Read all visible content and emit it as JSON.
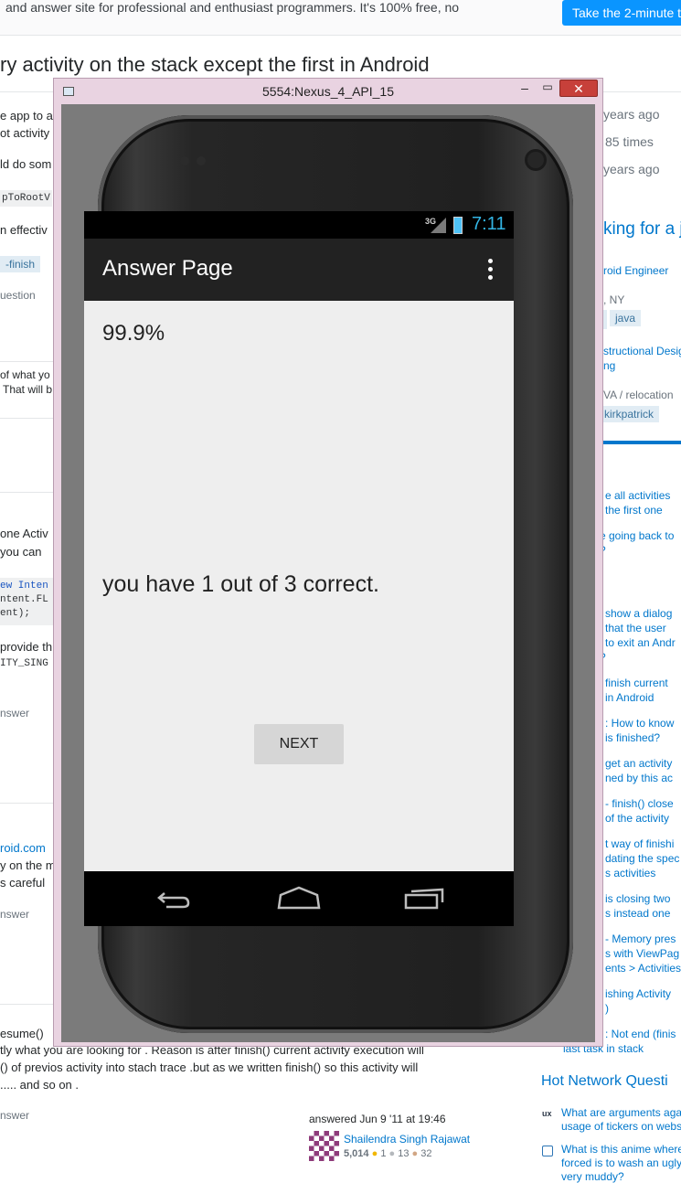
{
  "background_page": {
    "top_banner_text": "and answer site for professional and enthusiast programmers. It's 100% free, no",
    "tour_button_label": "Take the 2-minute tour",
    "question_title": "ry activity on the stack except the first in Android",
    "question_snippets": [
      "e app to a",
      "ot activity",
      "ld do som",
      "n effectiv"
    ],
    "code_snippet_1": "pToRootV",
    "tag_finish": "-finish",
    "question_link_text": "uestion",
    "comment_lines": [
      "of what yo",
      "That will b"
    ],
    "answer1_lines": [
      "one Activ",
      "you can"
    ],
    "answer1_code": [
      "ew Inten",
      "ntent.FL",
      "ent);"
    ],
    "answer1_more": [
      "provide th",
      "ITY_SING"
    ],
    "answer_label": "nswer",
    "answer2_link": "roid.com",
    "answer2_lines": [
      "y on the m",
      "s careful"
    ],
    "answer3_lines": [
      "esume()",
      "tly what you are looking for . Reason is after finish() current activity execution will",
      "() of previos activity into stach trace .but as we written finish() so this activity will",
      "..... and so on ."
    ],
    "answered_text": "answered Jun 9 '11 at 19:46",
    "user_name": "Shailendra Singh Rajawat",
    "user_rep": "5,014",
    "badges_gold": "1",
    "badges_silver": "13",
    "badges_bronze": "32"
  },
  "sidebar": {
    "stats": [
      "years ago",
      "85 times",
      "years ago"
    ],
    "hiring_title": "king for a j",
    "job_title": "roid Engineer",
    "job_location": ", NY",
    "job_tag": "java",
    "job2_lines": [
      "structional Desig",
      "ng"
    ],
    "job2_location": "VA / relocation",
    "job2_company": "kirkpatrick",
    "related": [
      [
        "e all activities",
        "the first one"
      ],
      [
        "e going back to",
        "?"
      ],
      [
        "show a dialog",
        "that the user",
        "to exit an Andr",
        "?"
      ],
      [
        "finish current",
        "in Android"
      ],
      [
        ": How to know",
        "is finished?"
      ],
      [
        "get an activity",
        "ned by this ac"
      ],
      [
        "- finish() close",
        "of the activity"
      ],
      [
        "t way of finishi",
        "dating the spec",
        "s activities"
      ],
      [
        "is closing two",
        "s instead one"
      ],
      [
        "- Memory pres",
        "s with ViewPag",
        "ents > Activities"
      ],
      [
        "ishing Activity",
        ")"
      ],
      [
        ": Not end (finis",
        "last task in stack"
      ]
    ],
    "hot_network_title": "Hot Network Questi",
    "hot_items": [
      {
        "icon": "ux",
        "lines": [
          "What are arguments aga",
          "usage of tickers on webs"
        ]
      },
      {
        "icon": "anime",
        "lines": [
          "What is this anime where",
          "forced is to wash an ugly",
          "very muddy?"
        ]
      }
    ]
  },
  "emulator": {
    "window_title": "5554:Nexus_4_API_15",
    "min_label": "–",
    "max_label": "▭",
    "close_label": "✕",
    "status_network": "3G",
    "status_time": "7:11",
    "app_title": "Answer Page",
    "score_text": "99.9%",
    "result_text": "you have 1 out of 3 correct.",
    "next_button_label": "NEXT"
  },
  "colors": {
    "accent_blue": "#0077cc",
    "tour_button": "#0a95ff",
    "emulator_frame": "#e9d3e1",
    "close_red": "#c7403a",
    "holo_blue": "#33b5e5",
    "actionbar": "#222222"
  }
}
